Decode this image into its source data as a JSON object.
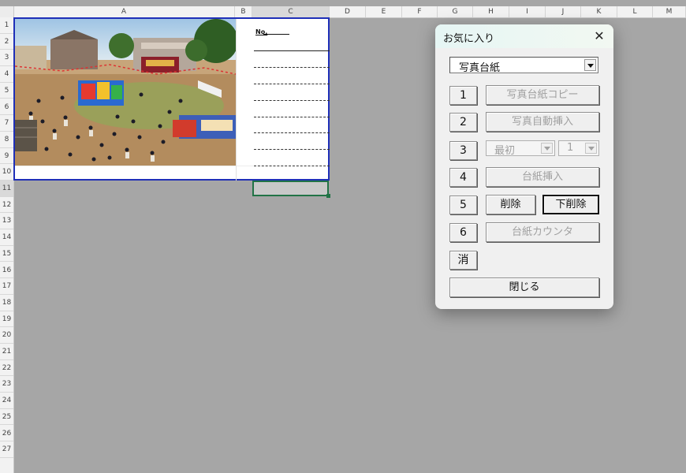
{
  "columns": [
    "A",
    "B",
    "C",
    "D",
    "E",
    "F",
    "G",
    "H",
    "I",
    "J",
    "K",
    "L",
    "M"
  ],
  "selected_column": "C",
  "rows": [
    "1",
    "2",
    "3",
    "4",
    "5",
    "6",
    "7",
    "8",
    "9",
    "10",
    "11",
    "12",
    "13",
    "14",
    "15",
    "16",
    "17",
    "18",
    "19",
    "20",
    "21",
    "22",
    "23",
    "24",
    "25",
    "26",
    "27"
  ],
  "selected_row": "11",
  "sheet": {
    "no_label": "No."
  },
  "dialog": {
    "title": "お気に入り",
    "close_glyph": "✕",
    "combo_value": "写真台紙",
    "row_buttons": [
      {
        "num": "1",
        "action": "写真台紙コピー"
      },
      {
        "num": "2",
        "action": "写真自動挿入"
      },
      {
        "num": "3",
        "select1": "最初",
        "select2": "1"
      },
      {
        "num": "4",
        "action": "台紙挿入"
      },
      {
        "num": "5",
        "delete": "削除",
        "delete_below": "下削除"
      },
      {
        "num": "6",
        "action": "台紙カウンタ"
      },
      {
        "num": "消"
      }
    ],
    "close_button": "閉じる"
  },
  "colors": {
    "sheet_border": "#1f2fb8",
    "selection": "#217346",
    "background": "#a6a6a6"
  }
}
